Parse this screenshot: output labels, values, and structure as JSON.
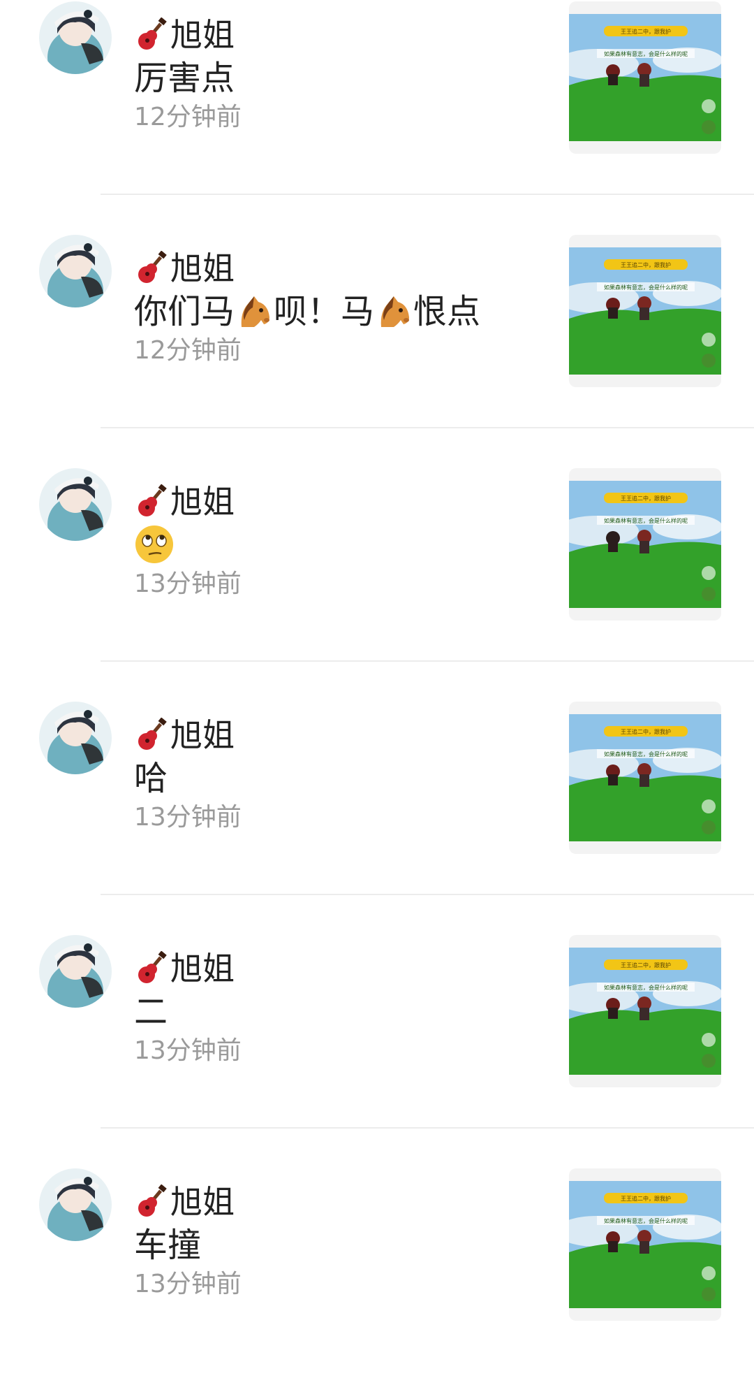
{
  "comments": [
    {
      "author": "旭姐",
      "message": "厉害点",
      "time": "12分钟前"
    },
    {
      "author": "旭姐",
      "message_parts": [
        "你们马",
        "呗！马",
        "恨点"
      ],
      "time": "12分钟前"
    },
    {
      "author": "旭姐",
      "message": "",
      "emoji": "face-with-rolling-eyes",
      "time": "13分钟前"
    },
    {
      "author": "旭姐",
      "message": "哈",
      "time": "13分钟前"
    },
    {
      "author": "旭姐",
      "message": "二",
      "time": "13分钟前"
    },
    {
      "author": "旭姐",
      "message": "车撞",
      "time": "13分钟前"
    }
  ],
  "icons": {
    "name_prefix": "guitar-icon",
    "inline_emoji": "horse-face-icon"
  },
  "thumbnail": {
    "title_text": "如果森林有意志，会是什么样的呢",
    "colors": {
      "sky": "#8fc3e8",
      "grass": "#33a12a",
      "banner": "#f2c516"
    }
  }
}
